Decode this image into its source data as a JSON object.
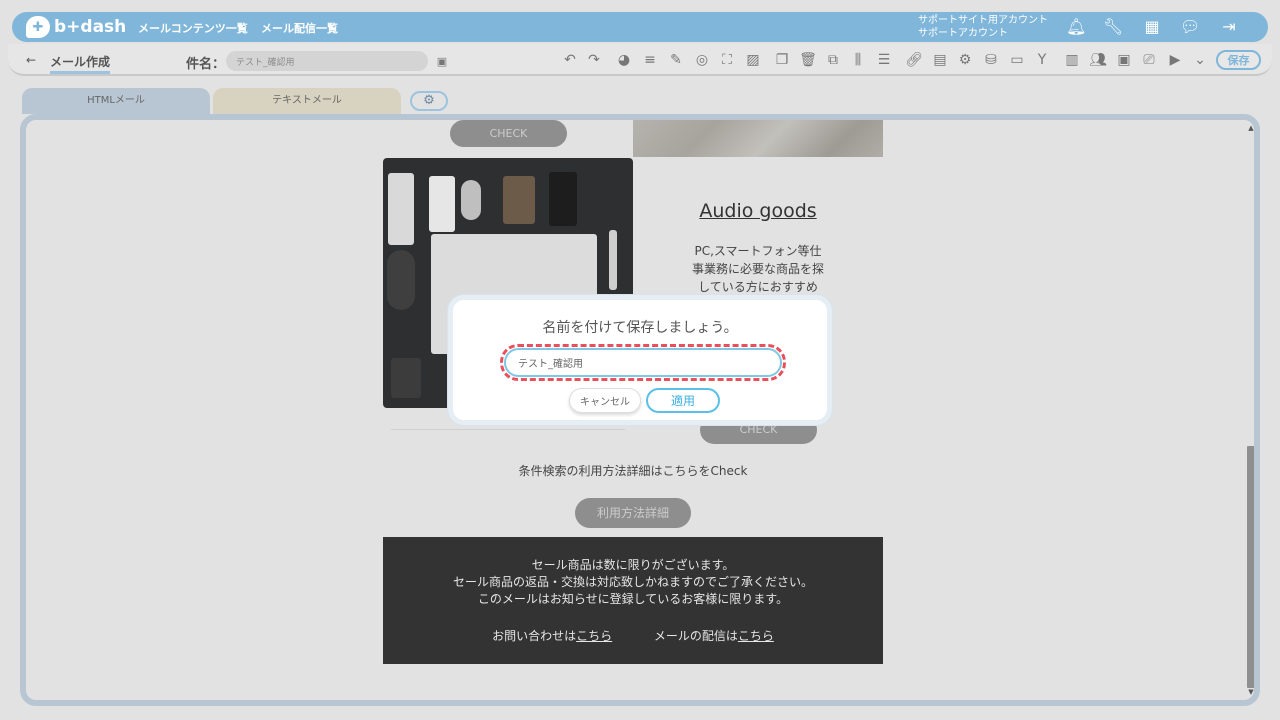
{
  "header": {
    "logo_text": "b+dash",
    "nav": [
      "メールコンテンツ一覧",
      "メール配信一覧"
    ],
    "account_line1": "サポートサイト用アカウント",
    "account_line2": "サポートアカウント",
    "icons": [
      "bell-icon",
      "wrench-icon",
      "apps-grid-icon",
      "chat-icon",
      "logout-icon"
    ]
  },
  "toolbar": {
    "back_glyph": "←",
    "page_title": "メール作成",
    "subject_label": "件名：",
    "subject_value": "テスト_確認用",
    "save_label": "保存"
  },
  "tabs": {
    "html": "HTMLメール",
    "text": "テキストメール"
  },
  "mail": {
    "check_button_top": "CHECK",
    "audio_title": "Audio goods",
    "audio_desc_lines": [
      "PC,スマートフォン等仕",
      "事業務に必要な商品を探",
      "している方におすすめ"
    ],
    "check_button_bottom": "CHECK",
    "condition_text": "条件検索の利用方法詳細はこちらをCheck",
    "detail_button": "利用方法詳細",
    "footer_lines": [
      "セール商品は数に限りがございます。",
      "セール商品の返品・交換は対応致しかねますのでご了承ください。",
      "このメールはお知らせに登録しているお客様に限ります。"
    ],
    "footer_contact_prefix": "お問い合わせは",
    "footer_contact_link": "こちら",
    "footer_delivery_prefix": "メールの配信は",
    "footer_delivery_link": "こちら"
  },
  "dialog": {
    "title": "名前を付けて保存しましょう。",
    "input_value": "テスト_確認用",
    "cancel_label": "キャンセル",
    "apply_label": "適用"
  }
}
